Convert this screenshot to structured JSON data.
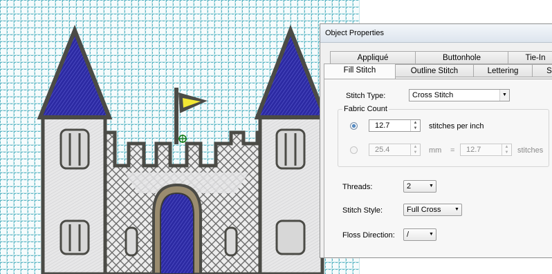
{
  "dialog": {
    "title": "Object Properties",
    "tabs_back": [
      "Appliqué",
      "Buttonhole",
      "Tie-In"
    ],
    "tabs_front": [
      "Fill Stitch",
      "Outline Stitch",
      "Lettering",
      "S"
    ],
    "active_tab": "Fill Stitch"
  },
  "fill": {
    "stitch_type_label": "Stitch Type:",
    "stitch_type_value": "Cross Stitch",
    "fabric_count_label": "Fabric Count",
    "spi_value": "12.7",
    "spi_unit": "stitches per inch",
    "mm_value": "25.4",
    "mm_unit": "mm",
    "equals": "=",
    "stitches_value": "12.7",
    "stitches_unit": "stitches",
    "threads_label": "Threads:",
    "threads_value": "2",
    "stitch_style_label": "Stitch Style:",
    "stitch_style_value": "Full Cross",
    "floss_direction_label": "Floss Direction:",
    "floss_direction_value": "/"
  },
  "colors": {
    "fabric": "#bfe3e8",
    "grid": "#49b3c4",
    "outline": "#4d4d49",
    "tower_roof": "#2e2aa0",
    "wall": "#e9e9ea",
    "door": "#3535a8",
    "flag": "#f0e02a"
  }
}
